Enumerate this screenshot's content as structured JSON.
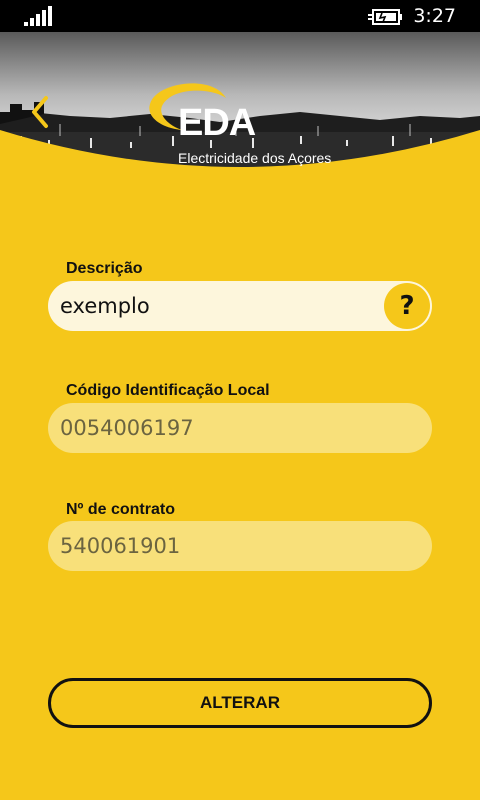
{
  "status_bar": {
    "time": "3:27"
  },
  "header": {
    "logo_text": "EDA",
    "logo_subtitle": "Electricidade dos Açores"
  },
  "form": {
    "descricao": {
      "label": "Descrição",
      "value": "exemplo",
      "help_label": "?"
    },
    "codigo": {
      "label": "Código Identificação Local",
      "value": "0054006197"
    },
    "contrato": {
      "label": "Nº de contrato",
      "value": "540061901"
    }
  },
  "actions": {
    "alterar_label": "ALTERAR"
  },
  "colors": {
    "background": "#f5c71a",
    "status_bar": "#000000",
    "active_field": "#fdf6dc",
    "readonly_field": "#f8e07a",
    "text": "#111111"
  }
}
